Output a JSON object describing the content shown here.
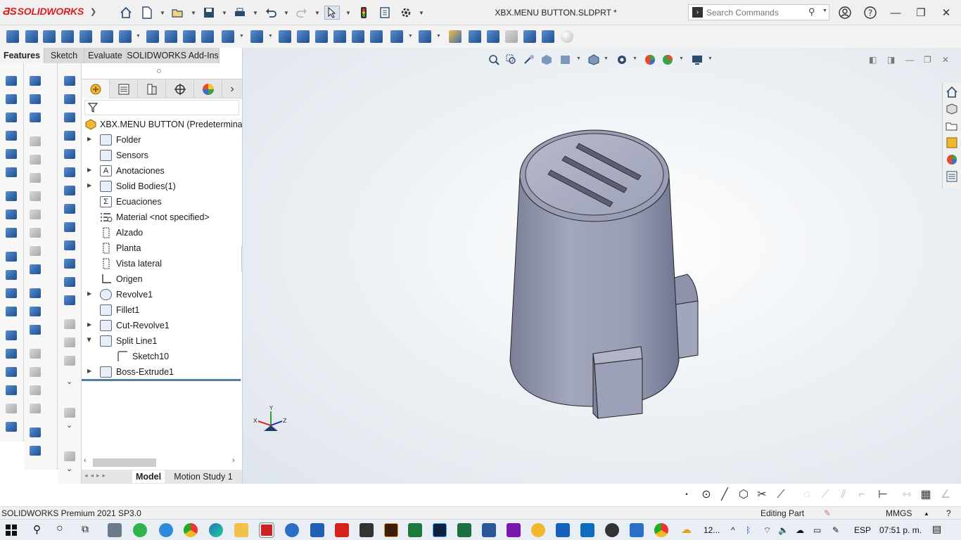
{
  "app": {
    "brand": "SOLIDWORKS",
    "document_title": "XBX.MENU BUTTON.SLDPRT *"
  },
  "search": {
    "placeholder": "Search Commands"
  },
  "tabs": [
    {
      "label": "Features"
    },
    {
      "label": "Sketch"
    },
    {
      "label": "Evaluate"
    },
    {
      "label": "SOLIDWORKS Add-Ins"
    }
  ],
  "tree": {
    "root": "XBX.MENU BUTTON  (Predeterminado",
    "items": [
      {
        "label": "Folder",
        "icon": "folder-icon"
      },
      {
        "label": "Sensors",
        "icon": "sensors-icon"
      },
      {
        "label": "Anotaciones",
        "icon": "annotations-icon"
      },
      {
        "label": "Solid Bodies(1)",
        "icon": "solid-bodies-icon"
      },
      {
        "label": "Ecuaciones",
        "icon": "equations-icon"
      },
      {
        "label": "Material <not specified>",
        "icon": "material-icon"
      },
      {
        "label": "Alzado",
        "icon": "plane-icon"
      },
      {
        "label": "Planta",
        "icon": "plane-icon"
      },
      {
        "label": "Vista lateral",
        "icon": "plane-icon"
      },
      {
        "label": "Origen",
        "icon": "origin-icon"
      },
      {
        "label": "Revolve1",
        "icon": "revolve-icon"
      },
      {
        "label": "Fillet1",
        "icon": "fillet-icon"
      },
      {
        "label": "Cut-Revolve1",
        "icon": "cut-revolve-icon"
      },
      {
        "label": "Split Line1",
        "icon": "split-line-icon"
      },
      {
        "label": "Sketch10",
        "icon": "sketch-icon"
      },
      {
        "label": "Boss-Extrude1",
        "icon": "boss-extrude-icon"
      }
    ]
  },
  "bottom_tabs": [
    {
      "label": "Model"
    },
    {
      "label": "Motion Study 1"
    }
  ],
  "triad": {
    "x": "X",
    "y": "Y",
    "z": "Z"
  },
  "status": {
    "version": "SOLIDWORKS Premium 2021 SP3.0",
    "mode": "Editing Part",
    "units": "MMGS"
  },
  "taskbar": {
    "weather": "12...",
    "language": "ESP",
    "time": "07:51 p. m."
  },
  "colors": {
    "brand_red": "#d81e1e",
    "model_grey": "#9ba0b6",
    "rollback_blue": "#4d7fa8"
  }
}
